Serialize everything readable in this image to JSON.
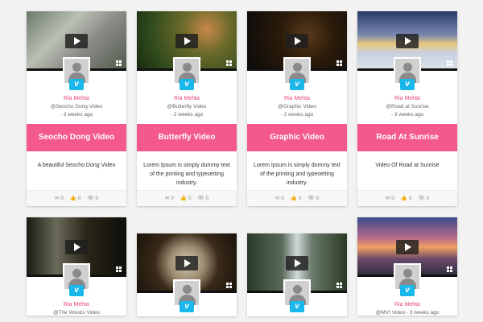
{
  "cards": [
    {
      "thumb": "street-scene",
      "author": "Ria Mehta",
      "handle": "@Seocho Dong Video",
      "time": "- 3 weeks ago",
      "title": "Seocho Dong Video",
      "desc": "A beautiful Seocho Dong Video",
      "comments": "0",
      "likes": "0",
      "views": "0"
    },
    {
      "thumb": "butterfly",
      "author": "Ria Mehta",
      "handle": "@Butterfly Video",
      "time": "- 2 weeks ago",
      "title": "Butterfly Video",
      "desc": "Lorem Ipsum is simply dummy text of the printing and typesetting industry.",
      "comments": "0",
      "likes": "0",
      "views": "0"
    },
    {
      "thumb": "dark-bokeh",
      "author": "Ria Mehta",
      "handle": "@Graphic Video",
      "time": "- 2 weeks ago",
      "title": "Graphic Video",
      "desc": "Lorem Ipsum is simply dummy text of the printing and typesetting industry.",
      "comments": "0",
      "likes": "0",
      "views": "0"
    },
    {
      "thumb": "sunrise-snow",
      "author": "Ria Mehta",
      "handle": "@Road at Sunrise",
      "time": "- 3 weeks ago",
      "title": "Road At Sunrise",
      "desc": "Video Of Road at Sunrise",
      "comments": "0",
      "likes": "0",
      "views": "0"
    },
    {
      "thumb": "forest-dark",
      "author": "Ria Mehta",
      "handle": "@The Woods Video",
      "time": "",
      "title": "",
      "desc": "",
      "comments": "",
      "likes": "",
      "views": ""
    },
    {
      "thumb": "clock",
      "author": "",
      "handle": "",
      "time": "",
      "title": "",
      "desc": "",
      "comments": "",
      "likes": "",
      "views": ""
    },
    {
      "thumb": "waterfall",
      "author": "",
      "handle": "",
      "time": "",
      "title": "",
      "desc": "",
      "comments": "",
      "likes": "",
      "views": ""
    },
    {
      "thumb": "sunset-lake",
      "author": "Ria Mehta",
      "handle": "@MVI Video",
      "time": "- 3 weeks ago",
      "title": "",
      "desc": "",
      "comments": "",
      "likes": "",
      "views": ""
    }
  ],
  "colors": {
    "accent": "#f4598e",
    "author": "#e8457a",
    "vimeo": "#1ab7ea"
  },
  "icons": {
    "play": "play-icon",
    "fullscreen": "fullscreen-icon",
    "vimeo": "vimeo-icon",
    "comment": "comment-icon",
    "like": "thumbs-up-icon",
    "view": "eye-icon"
  },
  "vimeo_glyph": "v",
  "stat_glyphs": {
    "comment": "✉",
    "like": "👍",
    "view": "👁"
  }
}
